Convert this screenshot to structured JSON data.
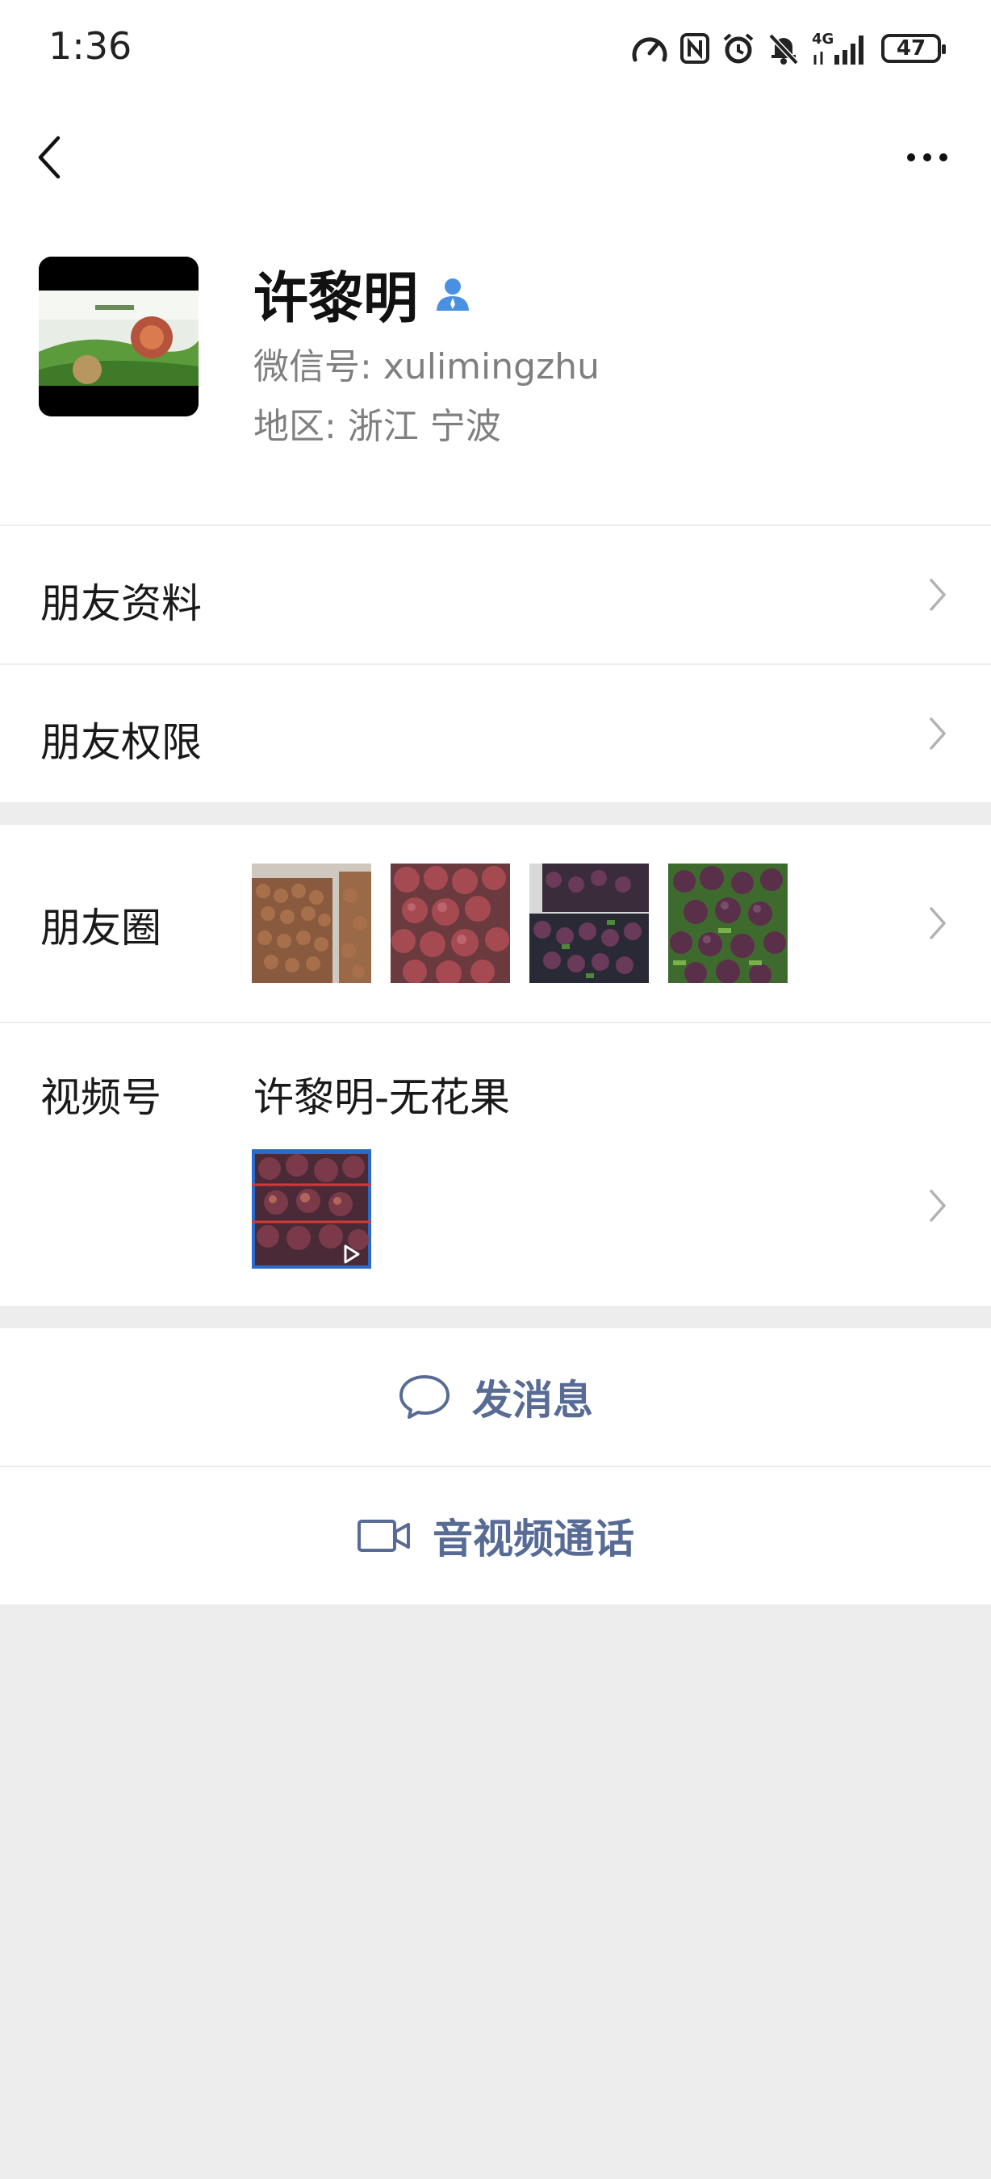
{
  "status_bar": {
    "time": "1:36",
    "network": "4G",
    "battery": "47",
    "icons": [
      "speedometer-icon",
      "nfc-icon",
      "alarm-icon",
      "mute-bell-icon",
      "signal-icon",
      "battery-icon"
    ]
  },
  "nav": {
    "back_icon": "chevron-left-icon",
    "more_icon": "more-dots-icon"
  },
  "profile": {
    "name": "许黎明",
    "verified_icon": "person-icon",
    "wechat_id": "微信号:  xulimingzhu",
    "region": "地区:  浙江  宁波"
  },
  "menu": {
    "friend_info": "朋友资料",
    "friend_permissions": "朋友权限",
    "moments": "朋友圈",
    "channels": "视频号",
    "channel_name": "许黎明-无花果"
  },
  "actions": {
    "send_message": "发消息",
    "video_call": "音视频通话"
  },
  "colors": {
    "link_blue": "#576b95",
    "background": "#ededed",
    "panel": "#ffffff",
    "verified_blue": "#4a90e2"
  }
}
